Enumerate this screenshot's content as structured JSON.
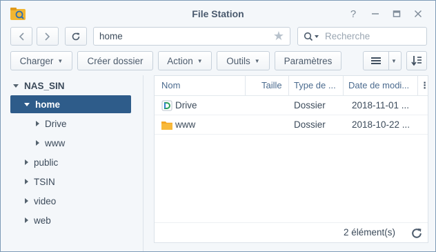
{
  "window": {
    "title": "File Station"
  },
  "nav": {
    "address": "home",
    "search_placeholder": "Recherche"
  },
  "toolbar": {
    "charger": "Charger",
    "creer_dossier": "Créer dossier",
    "action": "Action",
    "outils": "Outils",
    "parametres": "Paramètres"
  },
  "tree": {
    "root": "NAS_SIN",
    "items": [
      {
        "label": "home"
      },
      {
        "label": "Drive"
      },
      {
        "label": "www"
      },
      {
        "label": "public"
      },
      {
        "label": "TSIN"
      },
      {
        "label": "video"
      },
      {
        "label": "web"
      }
    ]
  },
  "table": {
    "columns": [
      "Nom",
      "Taille",
      "Type de ...",
      "Date de modi..."
    ],
    "rows": [
      {
        "name": "Drive",
        "size": "",
        "type": "Dossier",
        "date": "2018-11-01 ...",
        "icon": "drive-app-icon"
      },
      {
        "name": "www",
        "size": "",
        "type": "Dossier",
        "date": "2018-10-22 ...",
        "icon": "folder-icon"
      }
    ]
  },
  "status": {
    "count": "2 élément(s)"
  },
  "colors": {
    "selection": "#2e5c8a",
    "folder": "#f5a623",
    "header_text": "#4a6a8e"
  }
}
